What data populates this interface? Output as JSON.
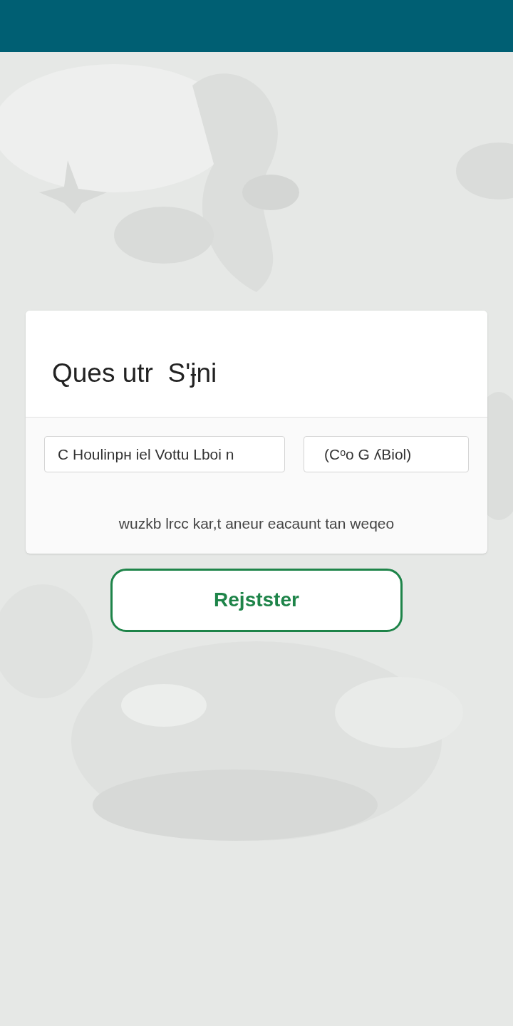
{
  "card": {
    "title": "Ques utr  S'ɉni",
    "fields": [
      {
        "value": "C Houlinpн iel Vottu Lboi n"
      },
      {
        "value": "(Cᵒo G ʎBiol)"
      }
    ],
    "note": "wuzkb lrcc kar,t aneur eacaunt tan weqeo"
  },
  "register_button": {
    "label": "Rejstster"
  }
}
